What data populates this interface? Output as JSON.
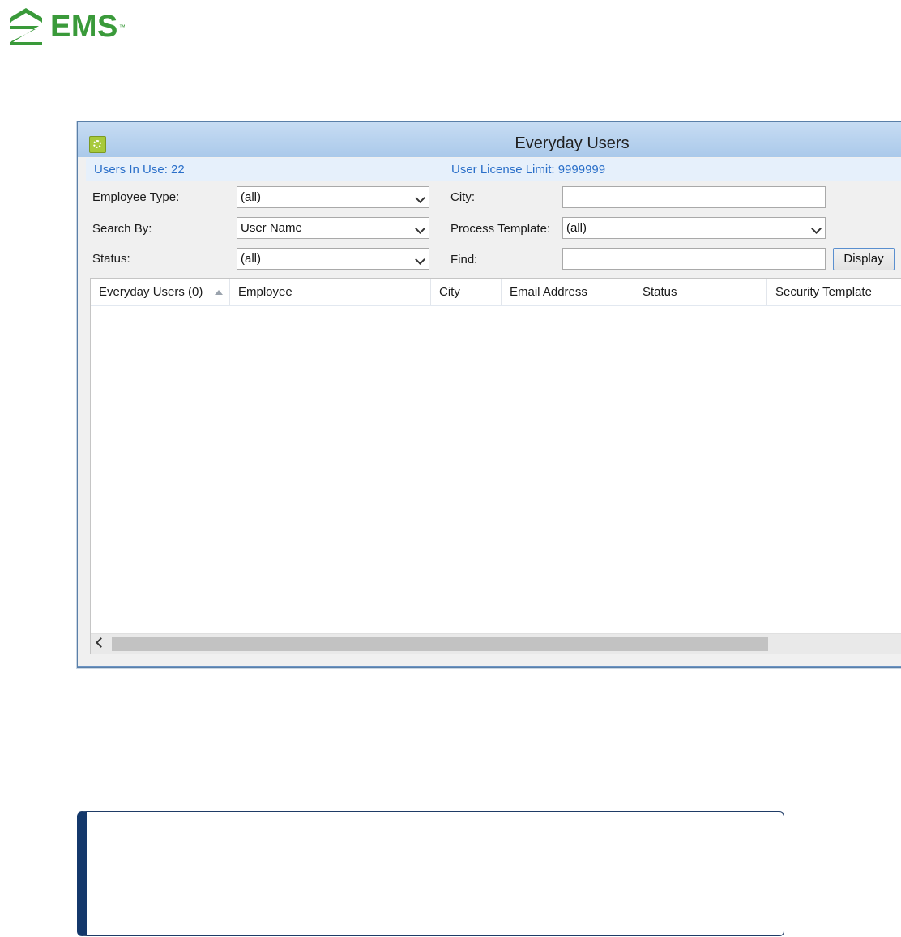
{
  "brand": {
    "name": "EMS",
    "trademark": "™",
    "color": "#3a9a3a"
  },
  "window": {
    "title": "Everyday Users",
    "users_in_use": "Users In Use: 22",
    "license_limit": "User License Limit: 9999999",
    "accent": "#2a6fc9"
  },
  "filters": {
    "employee_type": {
      "label": "Employee Type:",
      "value": "(all)"
    },
    "search_by": {
      "label": "Search By:",
      "value": "User Name"
    },
    "status": {
      "label": "Status:",
      "value": "(all)"
    },
    "city": {
      "label": "City:",
      "value": ""
    },
    "process_template": {
      "label": "Process Template:",
      "value": "(all)"
    },
    "find": {
      "label": "Find:",
      "value": ""
    },
    "display_button": "Display"
  },
  "grid": {
    "columns": [
      "Everyday Users (0)",
      "Employee",
      "City",
      "Email Address",
      "Status",
      "Security Template"
    ],
    "sorted_column": "Everyday Users (0)",
    "sort_direction": "ascending",
    "rows": []
  },
  "icons": {
    "logo": "ems-logo-icon",
    "app": "app-icon",
    "dropdown": "chevron-down-icon",
    "scroll_left": "chevron-left-icon",
    "sort": "sort-ascending-icon"
  }
}
